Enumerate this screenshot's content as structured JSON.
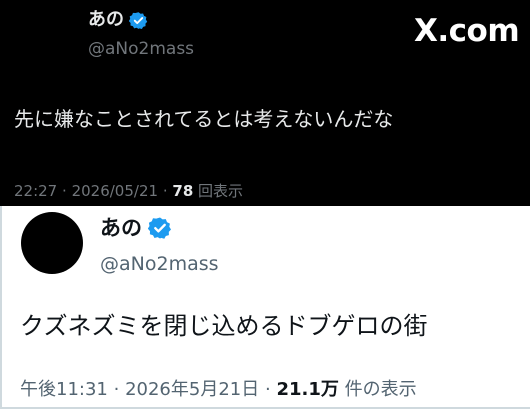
{
  "site": {
    "brand": "X.com"
  },
  "dark_post": {
    "name": "あの",
    "handle": "@aNo2mass",
    "text": "先に嫌なことされてるとは考えないんだな",
    "time": "22:27",
    "date": "2026/05/21",
    "separator": "·",
    "views_count": "78",
    "views_label": "回表示"
  },
  "light_post": {
    "name": "あの",
    "handle": "@aNo2mass",
    "text": "クズネズミを閉じ込めるドブゲロの街",
    "time": "午後11:31",
    "date": "2026年5月21日",
    "separator": "·",
    "views_count": "21.1万",
    "views_label": "件の表示"
  },
  "colors": {
    "verified_blue": "#1d9bf0",
    "dark_bg": "#000000",
    "light_bg": "#ffffff"
  }
}
